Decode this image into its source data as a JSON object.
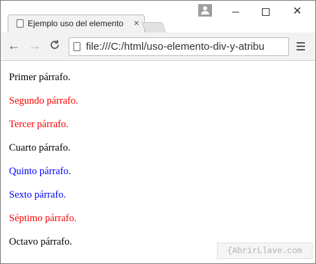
{
  "tab": {
    "title": "Ejemplo uso del elemento",
    "close": "×"
  },
  "window": {
    "close": "✕"
  },
  "toolbar": {
    "back": "←",
    "forward": "→",
    "reload": "C",
    "url": "file:///C:/html/uso-elemento-div-y-atribu"
  },
  "paragraphs": [
    {
      "text": "Primer párrafo.",
      "color": "#000000"
    },
    {
      "text": "Segundo párrafo.",
      "color": "#ff0000"
    },
    {
      "text": "Tercer párrafo.",
      "color": "#ff0000"
    },
    {
      "text": "Cuarto párrafo.",
      "color": "#000000"
    },
    {
      "text": "Quinto párrafo.",
      "color": "#0000ff"
    },
    {
      "text": "Sexto párrafo.",
      "color": "#0000ff"
    },
    {
      "text": "Séptimo párrafo.",
      "color": "#ff0000"
    },
    {
      "text": "Octavo párrafo.",
      "color": "#000000"
    }
  ],
  "watermark": "{AbrirLlave.com"
}
